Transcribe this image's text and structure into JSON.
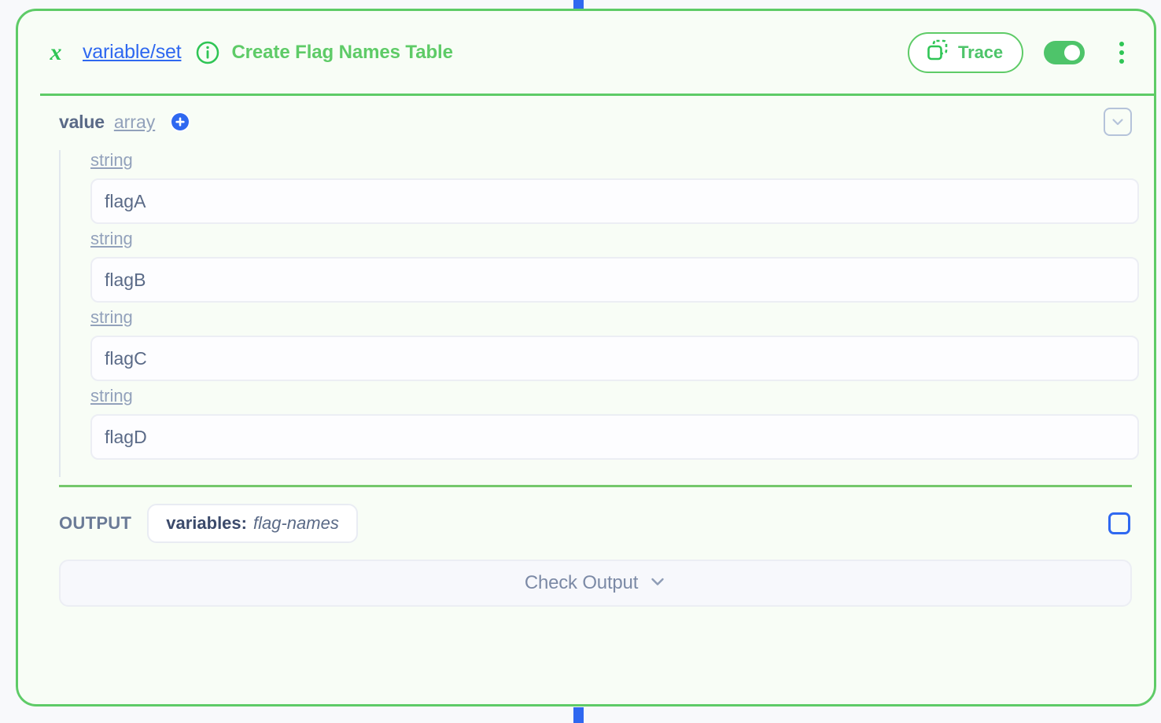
{
  "connectors": {
    "top": "input-connector",
    "bottom": "output-connector"
  },
  "header": {
    "icon": "variable-x-icon",
    "node_type": "variable/set",
    "info_icon": "info-icon",
    "title": "Create Flag Names Table",
    "trace_label": "Trace",
    "trace_icon": "trace-copy-icon",
    "toggle_state": "on",
    "menu_icon": "kebab-menu-icon"
  },
  "param": {
    "name": "value",
    "type": "array",
    "add_icon": "plus-circle-icon",
    "collapse_icon": "chevron-down-icon"
  },
  "array_items": [
    {
      "type": "string",
      "value": "flagA",
      "placeholder": ""
    },
    {
      "type": "string",
      "value": "flagB",
      "placeholder": ""
    },
    {
      "type": "string",
      "value": "flagC",
      "placeholder": ""
    },
    {
      "type": "string",
      "value": "flagD",
      "placeholder": ""
    }
  ],
  "output": {
    "label": "OUTPUT",
    "chip_key": "variables:",
    "chip_value": "flag-names",
    "checkbox_checked": false
  },
  "check_output": {
    "label": "Check Output",
    "icon": "chevron-down-icon"
  },
  "colors": {
    "accent_green": "#5ecb67",
    "link_blue": "#2f68f0",
    "slate": "#5a6a87",
    "muted": "#92a1bb",
    "card_bg": "#f8fdf6"
  }
}
